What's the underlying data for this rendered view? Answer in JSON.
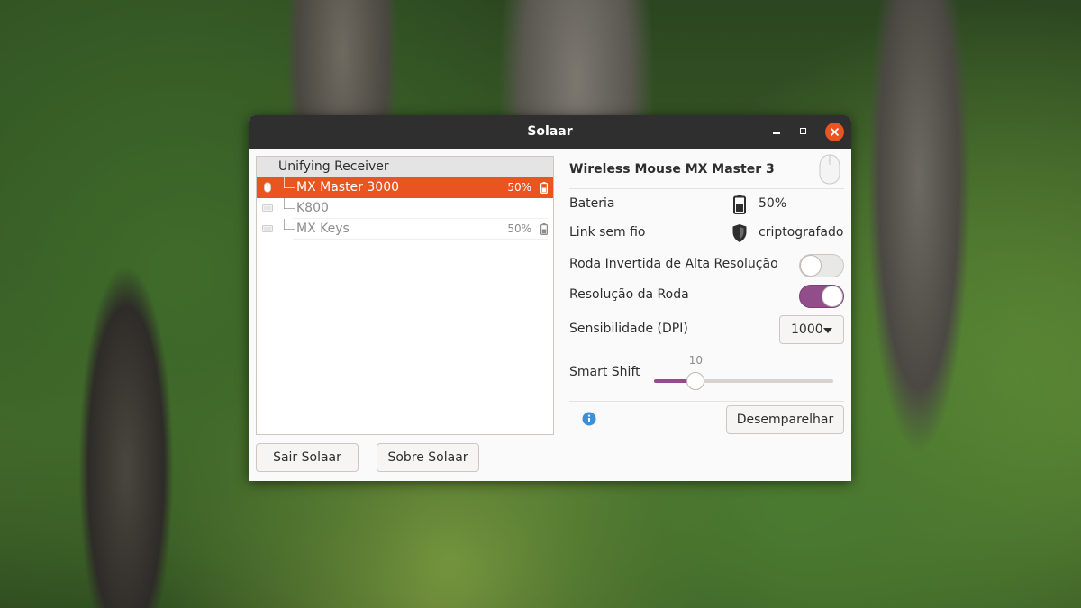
{
  "window": {
    "title": "Solaar"
  },
  "receiver": {
    "label": "Unifying Receiver"
  },
  "devices": [
    {
      "name": "MX Master 3000",
      "battery": "50%",
      "selected": true,
      "icon": "mouse-icon"
    },
    {
      "name": "K800",
      "battery": "",
      "selected": false,
      "icon": "keyboard-icon"
    },
    {
      "name": "MX Keys",
      "battery": "50%",
      "selected": false,
      "icon": "keyboard-icon"
    }
  ],
  "buttons": {
    "quit": "Sair Solaar",
    "about": "Sobre Solaar",
    "unpair": "Desemparelhar"
  },
  "details": {
    "title": "Wireless Mouse MX Master 3",
    "battery_label": "Bateria",
    "battery_value": "50%",
    "link_label": "Link sem fio",
    "link_value": "criptografado",
    "hires_label": "Roda Invertida de Alta Resolução",
    "hires_on": false,
    "wheel_res_label": "Resolução da Roda",
    "wheel_res_on": true,
    "dpi_label": "Sensibilidade (DPI)",
    "dpi_value": "1000",
    "smartshift_label": "Smart Shift",
    "smartshift_value": "10",
    "smartshift_fraction": 0.2
  },
  "colors": {
    "accent": "#e95420",
    "toggle_on": "#924d8b",
    "titlebar": "#2f2f2f"
  }
}
